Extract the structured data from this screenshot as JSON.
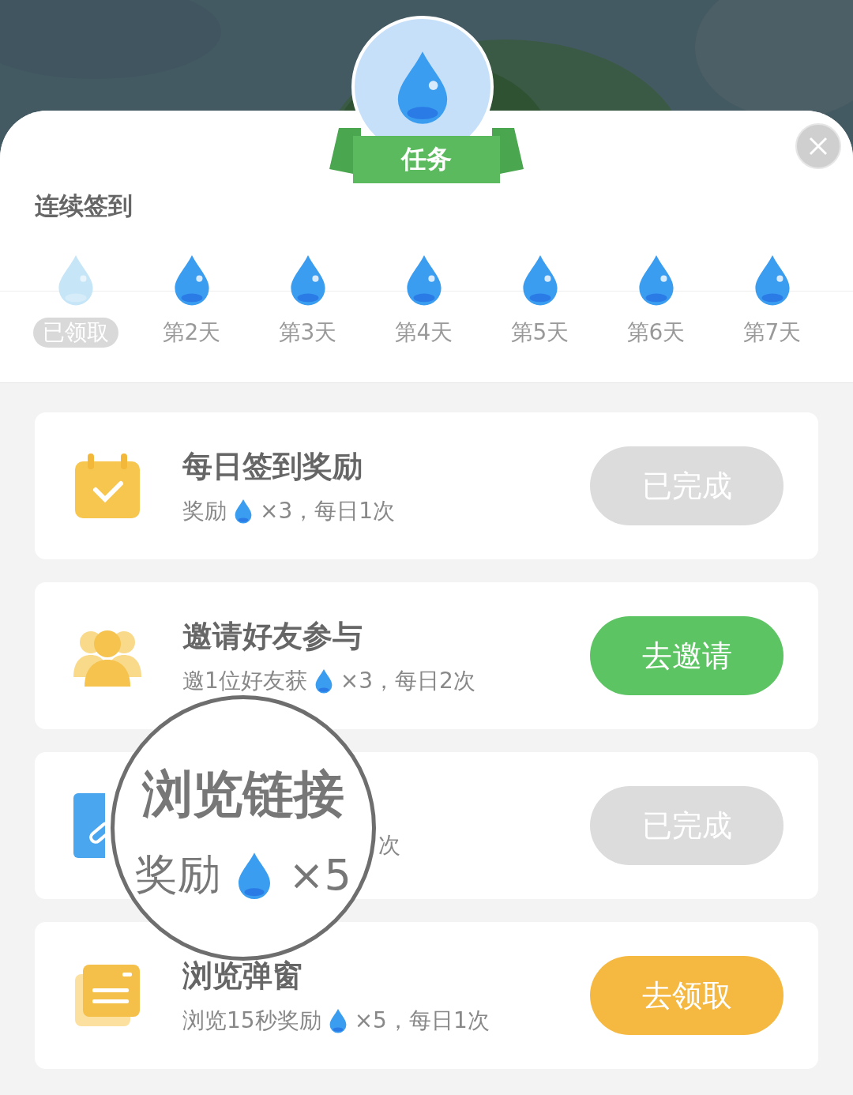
{
  "badge": {
    "label": "任务"
  },
  "checkin": {
    "title": "连续签到",
    "days": [
      {
        "label": "已领取",
        "claimed": true
      },
      {
        "label": "第2天",
        "claimed": false
      },
      {
        "label": "第3天",
        "claimed": false
      },
      {
        "label": "第4天",
        "claimed": false
      },
      {
        "label": "第5天",
        "claimed": false
      },
      {
        "label": "第6天",
        "claimed": false
      },
      {
        "label": "第7天",
        "claimed": false
      }
    ]
  },
  "tasks": [
    {
      "kind": "calendar",
      "title": "每日签到奖励",
      "reward_prefix": "奖励",
      "reward_suffix": "×3，每日1次",
      "button": {
        "label": "已完成",
        "kind": "done"
      }
    },
    {
      "kind": "people",
      "title": "邀请好友参与",
      "reward_prefix": "邀1位好友获",
      "reward_suffix": "×3，每日2次",
      "button": {
        "label": "去邀请",
        "kind": "invite"
      }
    },
    {
      "kind": "document",
      "reward_tail": "次",
      "button": {
        "label": "已完成",
        "kind": "done"
      }
    },
    {
      "kind": "window",
      "title": "浏览弹窗",
      "reward_prefix": "浏览15秒奖励",
      "reward_suffix": "×5，每日1次",
      "button": {
        "label": "去领取",
        "kind": "claim"
      }
    }
  ],
  "magnifier": {
    "title": "浏览链接",
    "reward_prefix": "奖励",
    "reward_suffix": "×5"
  }
}
